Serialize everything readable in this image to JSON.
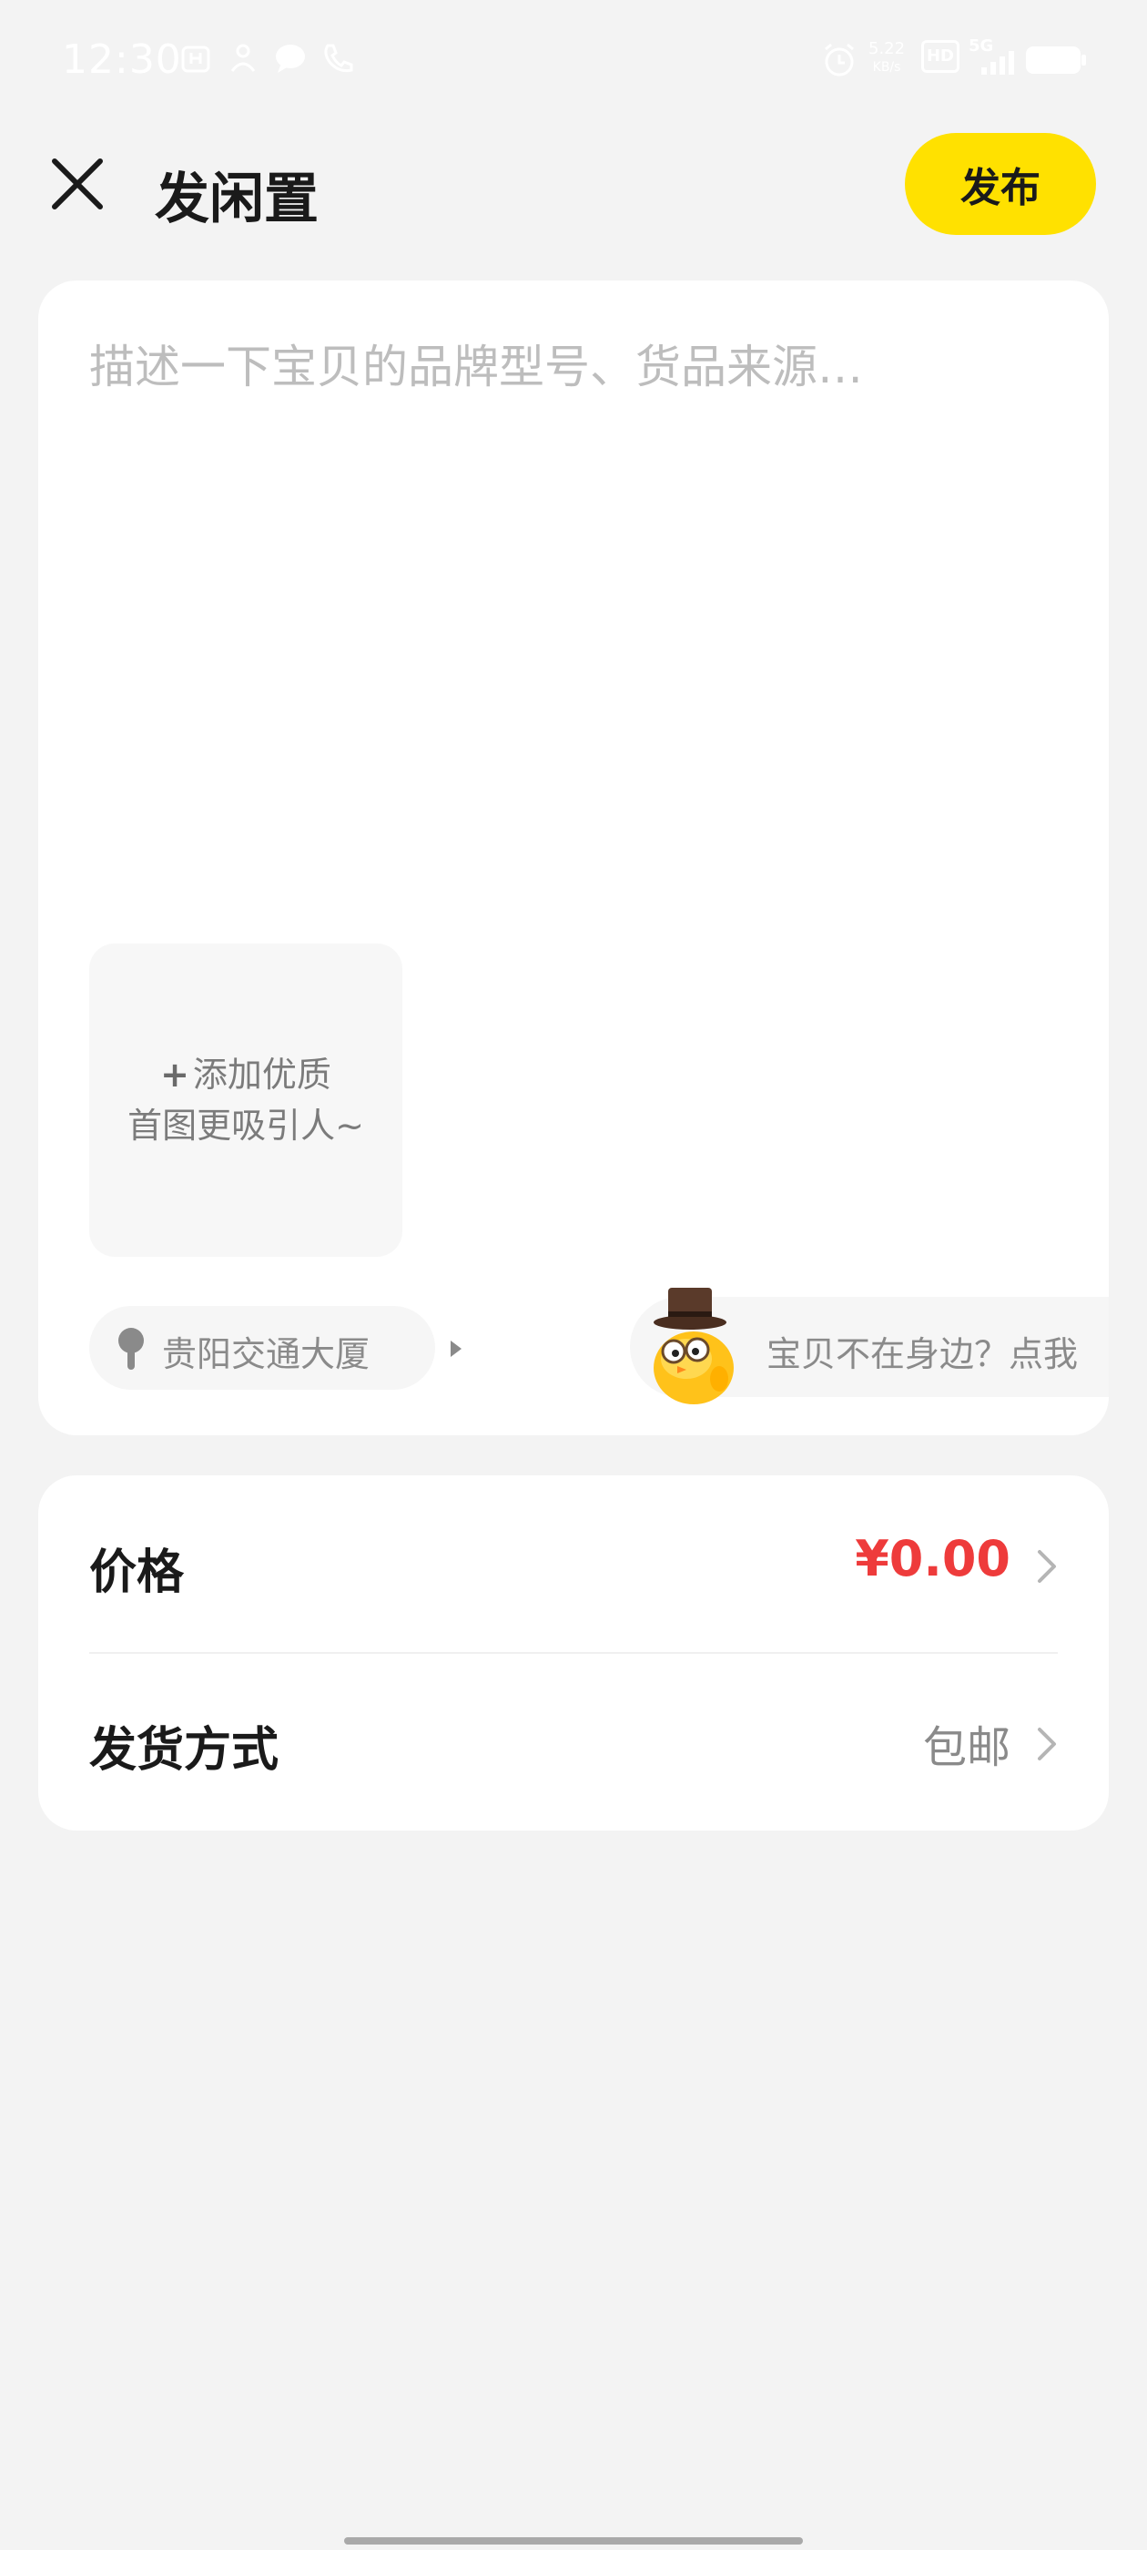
{
  "status_bar": {
    "time": "12:30",
    "network_speed_value": "5.22",
    "network_speed_unit": "KB/s",
    "hd_label": "HD",
    "signal_label": "5G",
    "icons": [
      "tiktok-icon",
      "person-icon",
      "message-icon",
      "phone-icon",
      "alarm-icon",
      "battery-icon"
    ]
  },
  "header": {
    "title": "发闲置",
    "publish_label": "发布"
  },
  "editor": {
    "placeholder": "描述一下宝贝的品牌型号、货品来源…",
    "add_photo_line1": "添加优质",
    "add_photo_line2": "首图更吸引人~",
    "location": "贵阳交通大厦",
    "helper_text": "宝贝不在身边？点我"
  },
  "settings": {
    "price_label": "价格",
    "price_value": "¥0.00",
    "shipping_label": "发货方式",
    "shipping_value": "包邮"
  },
  "colors": {
    "accent": "#ffe100",
    "price": "#ee3b3b",
    "background": "#f3f3f3"
  }
}
